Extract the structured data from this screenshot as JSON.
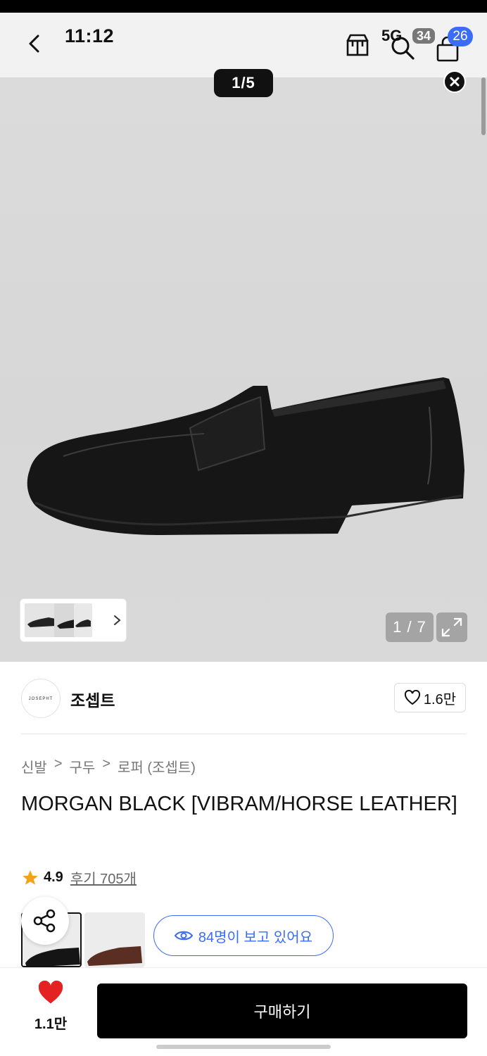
{
  "status_bar": {
    "time": "11:12",
    "network": "5G",
    "battery": "34"
  },
  "header": {
    "cart_count": "26"
  },
  "gallery": {
    "pager": "1/5",
    "counter": "1 / 7"
  },
  "brand": {
    "logo_text": "JOSEPHT",
    "name": "조셉트",
    "likes": "1.6만"
  },
  "breadcrumb": [
    "신발",
    "구두",
    "로퍼 (조셉트)"
  ],
  "breadcrumb_sep": ">",
  "product": {
    "title": "MORGAN BLACK [VIBRAM/HORSE LEATHER]",
    "rating": "4.9",
    "reviews": "후기 705개",
    "viewers": "84명이 보고 있어요"
  },
  "bottom": {
    "wish_count": "1.1만",
    "buy_label": "구매하기"
  },
  "colors": {
    "accent": "#3b6cf6",
    "heart": "#e52222",
    "primary": "#000000"
  }
}
